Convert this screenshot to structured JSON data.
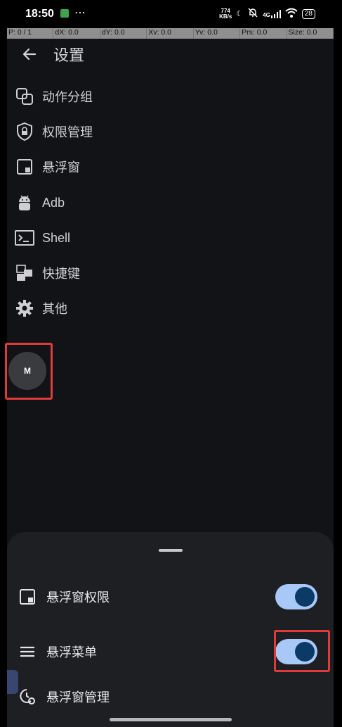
{
  "status_bar": {
    "time": "18:50",
    "net_speed_value": "774",
    "net_speed_unit": "KB/s",
    "signal_label": "4G",
    "battery": "28"
  },
  "pointer_bar": {
    "items": [
      "P: 0 / 1",
      "dX: 0.0",
      "dY: 0.0",
      "Xv: 0.0",
      "Yv: 0.0",
      "Prs: 0.0",
      "Size: 0.0"
    ]
  },
  "header": {
    "title": "设置"
  },
  "settings_menu": {
    "items": [
      {
        "label": "动作分组",
        "icon": "group-icon"
      },
      {
        "label": "权限管理",
        "icon": "shield-lock-icon"
      },
      {
        "label": "悬浮窗",
        "icon": "float-window-icon"
      },
      {
        "label": "Adb",
        "icon": "android-icon"
      },
      {
        "label": "Shell",
        "icon": "terminal-icon"
      },
      {
        "label": "快捷键",
        "icon": "shortcut-icon"
      },
      {
        "label": "其他",
        "icon": "gear-icon"
      }
    ]
  },
  "floating_ball": {
    "label": "M"
  },
  "sheet": {
    "rows": [
      {
        "label": "悬浮窗权限",
        "icon": "float-window-icon",
        "toggle": true
      },
      {
        "label": "悬浮菜单",
        "icon": "menu-icon",
        "toggle": true
      },
      {
        "label": "悬浮窗管理",
        "icon": "manage-icon"
      }
    ]
  },
  "colors": {
    "background": "#111316",
    "sheet": "#1e1f23",
    "toggle_track": "#a8c8f8",
    "toggle_knob": "#0c3a66",
    "highlight": "#e03a3a"
  }
}
